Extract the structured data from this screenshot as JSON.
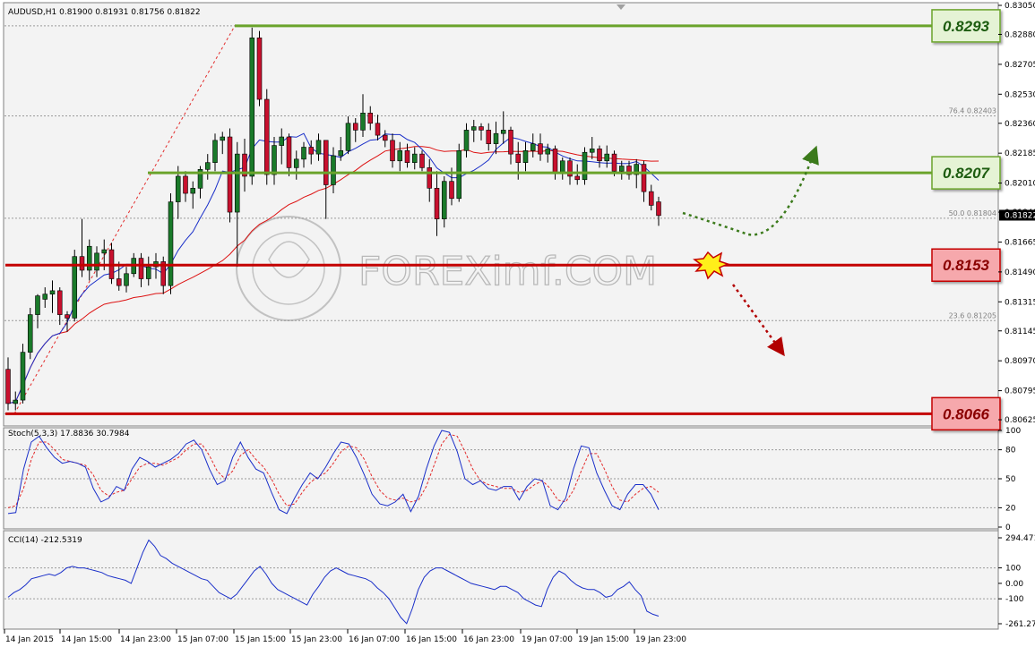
{
  "chart_data": [
    {
      "type": "candlestick",
      "symbol_header": "AUDUSD,H1  0.81900 0.81931 0.81756 0.81822",
      "ylim": [
        0.8062,
        0.8305
      ],
      "y_ticks": [
        "0.83050",
        "0.82880",
        "0.82705",
        "0.82530",
        "0.82360",
        "0.82185",
        "0.82010",
        "0.81840",
        "0.81665",
        "0.81490",
        "0.81315",
        "0.81145",
        "0.80970",
        "0.80795",
        "0.80625"
      ],
      "current_price_label": "0.81822",
      "x_ticks": [
        "14 Jan 2015",
        "14 Jan 15:00",
        "14 Jan 23:00",
        "15 Jan 07:00",
        "15 Jan 15:00",
        "15 Jan 23:00",
        "16 Jan 07:00",
        "16 Jan 15:00",
        "16 Jan 23:00",
        "19 Jan 07:00",
        "19 Jan 15:00",
        "19 Jan 23:00"
      ],
      "levels": [
        {
          "label": "0.8293",
          "value": 0.8293,
          "color": "#6aa32b",
          "box_fill": "#e5f3d5"
        },
        {
          "label": "0.8207",
          "value": 0.8207,
          "color": "#6aa32b",
          "box_fill": "#e5f3d5"
        },
        {
          "label": "0.8153",
          "value": 0.8153,
          "color": "#c40000",
          "box_fill": "#f6a8ac"
        },
        {
          "label": "0.8066",
          "value": 0.8066,
          "color": "#c40000",
          "box_fill": "#f6a8ac"
        }
      ],
      "fib_levels": [
        {
          "label": "76.4 0.82403",
          "value": 0.82403
        },
        {
          "label": "50.0 0.81804",
          "value": 0.81804
        },
        {
          "label": "23.6 0.81205",
          "value": 0.81205
        }
      ],
      "watermark": "FOREXimf.COM",
      "candles": [
        [
          0.8092,
          0.8099,
          0.8068,
          0.8072
        ],
        [
          0.8072,
          0.8079,
          0.8068,
          0.8074
        ],
        [
          0.8074,
          0.8107,
          0.8072,
          0.8102
        ],
        [
          0.8102,
          0.8128,
          0.8098,
          0.8124
        ],
        [
          0.8124,
          0.8136,
          0.8116,
          0.8135
        ],
        [
          0.8133,
          0.814,
          0.8128,
          0.8136
        ],
        [
          0.8136,
          0.8144,
          0.8125,
          0.8138
        ],
        [
          0.8138,
          0.814,
          0.8118,
          0.8124
        ],
        [
          0.8124,
          0.8126,
          0.8114,
          0.8122
        ],
        [
          0.8122,
          0.8162,
          0.812,
          0.8158
        ],
        [
          0.8158,
          0.818,
          0.8146,
          0.815
        ],
        [
          0.815,
          0.8168,
          0.8144,
          0.8164
        ],
        [
          0.815,
          0.8164,
          0.8146,
          0.816
        ],
        [
          0.816,
          0.8168,
          0.815,
          0.8162
        ],
        [
          0.8162,
          0.8166,
          0.8142,
          0.8145
        ],
        [
          0.8145,
          0.8155,
          0.8138,
          0.8141
        ],
        [
          0.8141,
          0.8152,
          0.8137,
          0.8148
        ],
        [
          0.8148,
          0.816,
          0.8146,
          0.8157
        ],
        [
          0.8157,
          0.816,
          0.814,
          0.8145
        ],
        [
          0.8145,
          0.8158,
          0.8141,
          0.8152
        ],
        [
          0.8152,
          0.816,
          0.8145,
          0.8155
        ],
        [
          0.8155,
          0.8158,
          0.8136,
          0.8141
        ],
        [
          0.8141,
          0.8195,
          0.8136,
          0.819
        ],
        [
          0.819,
          0.8211,
          0.818,
          0.8205
        ],
        [
          0.8205,
          0.8208,
          0.819,
          0.8195
        ],
        [
          0.8195,
          0.8202,
          0.8186,
          0.8198
        ],
        [
          0.8198,
          0.8211,
          0.8192,
          0.8209
        ],
        [
          0.8209,
          0.8218,
          0.8203,
          0.8213
        ],
        [
          0.8213,
          0.823,
          0.8208,
          0.8226
        ],
        [
          0.8226,
          0.8231,
          0.8218,
          0.8228
        ],
        [
          0.8228,
          0.8233,
          0.8178,
          0.8184
        ],
        [
          0.8184,
          0.8225,
          0.8152,
          0.8218
        ],
        [
          0.8218,
          0.8227,
          0.8196,
          0.8205
        ],
        [
          0.8205,
          0.8292,
          0.82,
          0.8286
        ],
        [
          0.8286,
          0.829,
          0.8246,
          0.825
        ],
        [
          0.825,
          0.8256,
          0.82,
          0.8206
        ],
        [
          0.8206,
          0.8228,
          0.82,
          0.8223
        ],
        [
          0.8223,
          0.8233,
          0.8212,
          0.8228
        ],
        [
          0.8228,
          0.823,
          0.8205,
          0.821
        ],
        [
          0.821,
          0.822,
          0.8203,
          0.8215
        ],
        [
          0.8215,
          0.8225,
          0.821,
          0.8222
        ],
        [
          0.8222,
          0.8226,
          0.8212,
          0.8218
        ],
        [
          0.8218,
          0.823,
          0.8214,
          0.8226
        ],
        [
          0.8226,
          0.8226,
          0.818,
          0.82
        ],
        [
          0.82,
          0.8222,
          0.8195,
          0.8217
        ],
        [
          0.8217,
          0.8228,
          0.8214,
          0.822
        ],
        [
          0.822,
          0.824,
          0.8218,
          0.8236
        ],
        [
          0.8236,
          0.8239,
          0.8225,
          0.8232
        ],
        [
          0.8232,
          0.8253,
          0.8228,
          0.8242
        ],
        [
          0.8242,
          0.8246,
          0.8232,
          0.8236
        ],
        [
          0.8236,
          0.8241,
          0.8226,
          0.8229
        ],
        [
          0.8229,
          0.8232,
          0.8222,
          0.8226
        ],
        [
          0.8226,
          0.823,
          0.821,
          0.8214
        ],
        [
          0.8214,
          0.8225,
          0.8208,
          0.822
        ],
        [
          0.822,
          0.8224,
          0.821,
          0.8213
        ],
        [
          0.8213,
          0.8222,
          0.8209,
          0.8218
        ],
        [
          0.8218,
          0.822,
          0.8208,
          0.821
        ],
        [
          0.821,
          0.8215,
          0.819,
          0.8198
        ],
        [
          0.8198,
          0.8208,
          0.817,
          0.818
        ],
        [
          0.818,
          0.8205,
          0.8175,
          0.8202
        ],
        [
          0.8202,
          0.821,
          0.8188,
          0.8192
        ],
        [
          0.8192,
          0.8224,
          0.819,
          0.822
        ],
        [
          0.822,
          0.8236,
          0.8216,
          0.8232
        ],
        [
          0.8232,
          0.8238,
          0.8225,
          0.8234
        ],
        [
          0.8234,
          0.8236,
          0.8226,
          0.8232
        ],
        [
          0.8232,
          0.8236,
          0.822,
          0.8224
        ],
        [
          0.8224,
          0.8237,
          0.8218,
          0.823
        ],
        [
          0.823,
          0.8243,
          0.8224,
          0.8232
        ],
        [
          0.8232,
          0.8234,
          0.8212,
          0.8218
        ],
        [
          0.8218,
          0.8225,
          0.8203,
          0.8213
        ],
        [
          0.8213,
          0.8225,
          0.8208,
          0.822
        ],
        [
          0.822,
          0.823,
          0.8216,
          0.8224
        ],
        [
          0.8224,
          0.823,
          0.8214,
          0.8218
        ],
        [
          0.8218,
          0.8224,
          0.8213,
          0.8221
        ],
        [
          0.8221,
          0.8223,
          0.8203,
          0.8207
        ],
        [
          0.8207,
          0.8216,
          0.8203,
          0.8214
        ],
        [
          0.8214,
          0.8216,
          0.82,
          0.8205
        ],
        [
          0.8205,
          0.8212,
          0.82,
          0.8203
        ],
        [
          0.8203,
          0.8222,
          0.82,
          0.8219
        ],
        [
          0.8219,
          0.8228,
          0.8215,
          0.8221
        ],
        [
          0.8221,
          0.8223,
          0.821,
          0.8214
        ],
        [
          0.8214,
          0.8223,
          0.821,
          0.8218
        ],
        [
          0.8218,
          0.822,
          0.8205,
          0.8208
        ],
        [
          0.8208,
          0.8214,
          0.8203,
          0.8211
        ],
        [
          0.8211,
          0.8214,
          0.8203,
          0.8206
        ],
        [
          0.8206,
          0.8215,
          0.8198,
          0.8212
        ],
        [
          0.8212,
          0.8214,
          0.819,
          0.8196
        ],
        [
          0.8196,
          0.82,
          0.8185,
          0.8188
        ],
        [
          0.819,
          0.8193,
          0.8176,
          0.8182
        ]
      ]
    },
    {
      "type": "line",
      "title": "Stoch(5,3,3) 17.8836 30.7984",
      "ylim": [
        0,
        100
      ],
      "y_ticks": [
        "100",
        "80",
        "50",
        "20",
        "0"
      ],
      "series": [
        {
          "values": [
            14,
            15,
            60,
            88,
            94,
            82,
            72,
            66,
            68,
            66,
            62,
            40,
            26,
            30,
            42,
            38,
            60,
            72,
            68,
            62,
            66,
            70,
            76,
            86,
            90,
            80,
            60,
            44,
            48,
            72,
            88,
            72,
            60,
            56,
            36,
            18,
            14,
            30,
            44,
            56,
            50,
            62,
            76,
            88,
            86,
            72,
            54,
            34,
            24,
            22,
            26,
            34,
            16,
            32,
            60,
            84,
            100,
            98,
            78,
            50,
            44,
            48,
            40,
            38,
            42,
            42,
            28,
            42,
            50,
            48,
            22,
            18,
            30,
            60,
            84,
            82,
            56,
            38,
            22,
            18,
            34,
            44,
            44,
            34,
            18
          ]
        },
        {
          "values": [
            20,
            22,
            40,
            70,
            88,
            88,
            80,
            70,
            68,
            66,
            64,
            54,
            38,
            32,
            36,
            38,
            50,
            62,
            66,
            66,
            64,
            68,
            72,
            80,
            86,
            86,
            74,
            58,
            50,
            58,
            74,
            80,
            70,
            62,
            50,
            34,
            22,
            24,
            36,
            46,
            52,
            56,
            66,
            78,
            84,
            82,
            70,
            52,
            38,
            30,
            28,
            30,
            26,
            28,
            42,
            64,
            86,
            96,
            94,
            78,
            60,
            48,
            44,
            42,
            40,
            40,
            36,
            38,
            44,
            48,
            40,
            28,
            26,
            38,
            58,
            76,
            76,
            60,
            42,
            28,
            26,
            34,
            40,
            42,
            36
          ]
        }
      ]
    },
    {
      "type": "line",
      "title": "CCI(14) -212.5319",
      "y_ticks": [
        "294.471",
        "100",
        "0.00",
        "-100",
        "-261.275"
      ],
      "ylim": [
        -261.275,
        294.471
      ],
      "series": [
        {
          "values": [
            -90,
            -60,
            -40,
            -10,
            30,
            40,
            50,
            60,
            50,
            70,
            100,
            110,
            100,
            100,
            90,
            80,
            70,
            50,
            40,
            30,
            20,
            0,
            100,
            200,
            280,
            240,
            180,
            160,
            130,
            110,
            90,
            70,
            50,
            30,
            20,
            -20,
            -60,
            -80,
            -100,
            -70,
            -20,
            30,
            80,
            110,
            60,
            0,
            -40,
            -60,
            -80,
            -100,
            -120,
            -140,
            -70,
            -20,
            40,
            80,
            100,
            80,
            60,
            50,
            40,
            30,
            10,
            -30,
            -60,
            -100,
            -160,
            -220,
            -260,
            -160,
            -40,
            40,
            80,
            100,
            100,
            80,
            60,
            40,
            20,
            0,
            -10,
            -20,
            -30,
            -40,
            -20,
            -20,
            -40,
            -60,
            -100,
            -120,
            -140,
            -150,
            -40,
            40,
            80,
            60,
            20,
            -10,
            -30,
            -40,
            -40,
            -60,
            -90,
            -80,
            -40,
            -20,
            10,
            -40,
            -80,
            -180,
            -200,
            -212
          ]
        }
      ]
    }
  ]
}
